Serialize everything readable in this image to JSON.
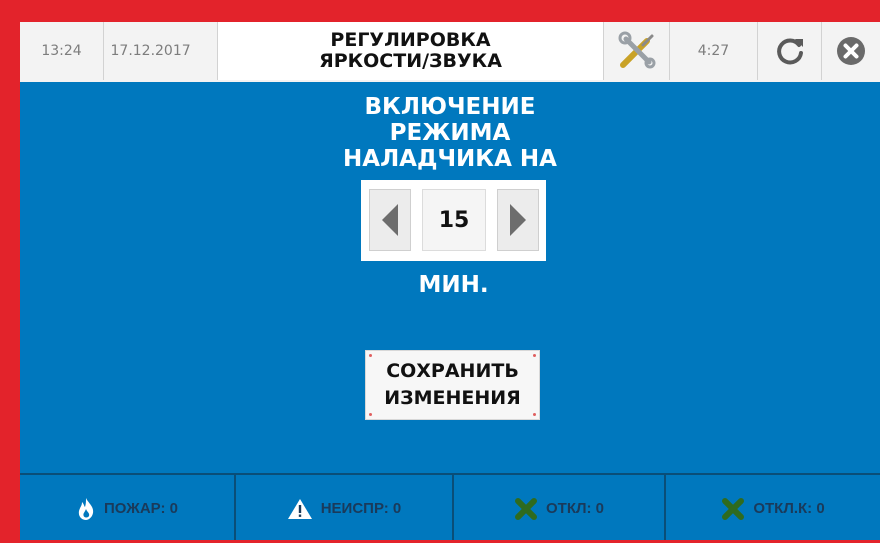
{
  "topbar": {
    "time": "13:24",
    "date": "17.12.2017",
    "title_line1": "РЕГУЛИРОВКА",
    "title_line2": "ЯРКОСТИ/ЗВУКА",
    "timer": "4:27",
    "settings_icon": "tools-icon",
    "refresh_icon": "refresh-icon",
    "close_icon": "close-icon"
  },
  "main": {
    "heading_line1": "ВКЛЮЧЕНИЕ",
    "heading_line2": "РЕЖИМА",
    "heading_line3": "НАЛАДЧИКА НА",
    "stepper_value": "15",
    "unit": "МИН.",
    "save_line1": "СОХРАНИТЬ",
    "save_line2": "ИЗМЕНЕНИЯ"
  },
  "statusbar": [
    {
      "icon": "fire-icon",
      "label": "ПОЖАР: 0"
    },
    {
      "icon": "warning-icon",
      "label": "НЕИСПР: 0"
    },
    {
      "icon": "disabled-x-icon",
      "label": "ОТКЛ: 0"
    },
    {
      "icon": "disabled-x-icon",
      "label": "ОТКЛ.К: 0"
    }
  ],
  "colors": {
    "frame": "#e3232b",
    "screen": "#0078be",
    "topbar": "#f3f3f3",
    "status_text": "#1a3a5a",
    "x_icon_green": "#2f6b1f"
  }
}
